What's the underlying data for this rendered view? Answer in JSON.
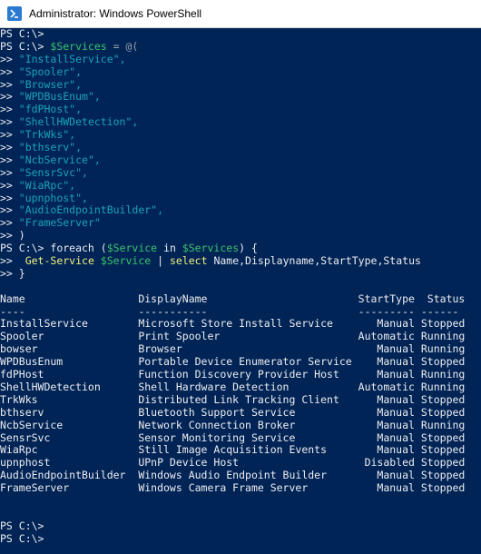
{
  "window": {
    "title": "Administrator: Windows PowerShell"
  },
  "console": {
    "prompt": "PS C:\\>",
    "cont": ">>",
    "assign": {
      "var": "$Services",
      "op": "=",
      "open": "@("
    },
    "services": [
      "\"InstallService\",",
      "\"Spooler\",",
      "\"Browser\",",
      "\"WPDBusEnum\",",
      "\"fdPHost\",",
      "\"ShellHWDetection\",",
      "\"TrkWks\",",
      "\"bthserv\",",
      "\"NcbService\",",
      "\"SensrSvc\",",
      "\"WiaRpc\",",
      "\"upnphost\",",
      "\"AudioEndpointBuilder\",",
      "\"FrameServer\""
    ],
    "close": ")",
    "foreach": {
      "kw": "foreach",
      "open": "(",
      "var": "$Service",
      "in": "in",
      "coll": "$Services",
      "close": ") {"
    },
    "body": {
      "cmdlet": "Get-Service",
      "var": "$Service",
      "pipe": "|",
      "select": "select",
      "args": "Name,Displayname,StartType,Status"
    },
    "end": "}",
    "table": {
      "headers": [
        "Name",
        "DisplayName",
        "StartType",
        "Status"
      ],
      "rules": [
        "----",
        "-----------",
        "---------",
        "------"
      ],
      "rows": [
        [
          "InstallService",
          "Microsoft Store Install Service",
          "Manual",
          "Stopped"
        ],
        [
          "Spooler",
          "Print Spooler",
          "Automatic",
          "Running"
        ],
        [
          "bowser",
          "Browser",
          "Manual",
          "Running"
        ],
        [
          "WPDBusEnum",
          "Portable Device Enumerator Service",
          "Manual",
          "Stopped"
        ],
        [
          "fdPHost",
          "Function Discovery Provider Host",
          "Manual",
          "Running"
        ],
        [
          "ShellHWDetection",
          "Shell Hardware Detection",
          "Automatic",
          "Running"
        ],
        [
          "TrkWks",
          "Distributed Link Tracking Client",
          "Manual",
          "Stopped"
        ],
        [
          "bthserv",
          "Bluetooth Support Service",
          "Manual",
          "Stopped"
        ],
        [
          "NcbService",
          "Network Connection Broker",
          "Manual",
          "Running"
        ],
        [
          "SensrSvc",
          "Sensor Monitoring Service",
          "Manual",
          "Stopped"
        ],
        [
          "WiaRpc",
          "Still Image Acquisition Events",
          "Manual",
          "Stopped"
        ],
        [
          "upnphost",
          "UPnP Device Host",
          "Disabled",
          "Stopped"
        ],
        [
          "AudioEndpointBuilder",
          "Windows Audio Endpoint Builder",
          "Manual",
          "Stopped"
        ],
        [
          "FrameServer",
          "Windows Camera Frame Server",
          "Manual",
          "Stopped"
        ]
      ]
    }
  },
  "colors": {
    "background": "#012456",
    "text": "#eeedf0",
    "variable": "#3ac46b",
    "string": "#1aa3b5",
    "cmdlet": "#f2f07a",
    "operator": "#9aa3ad"
  },
  "icons": {
    "app": "powershell-icon"
  }
}
